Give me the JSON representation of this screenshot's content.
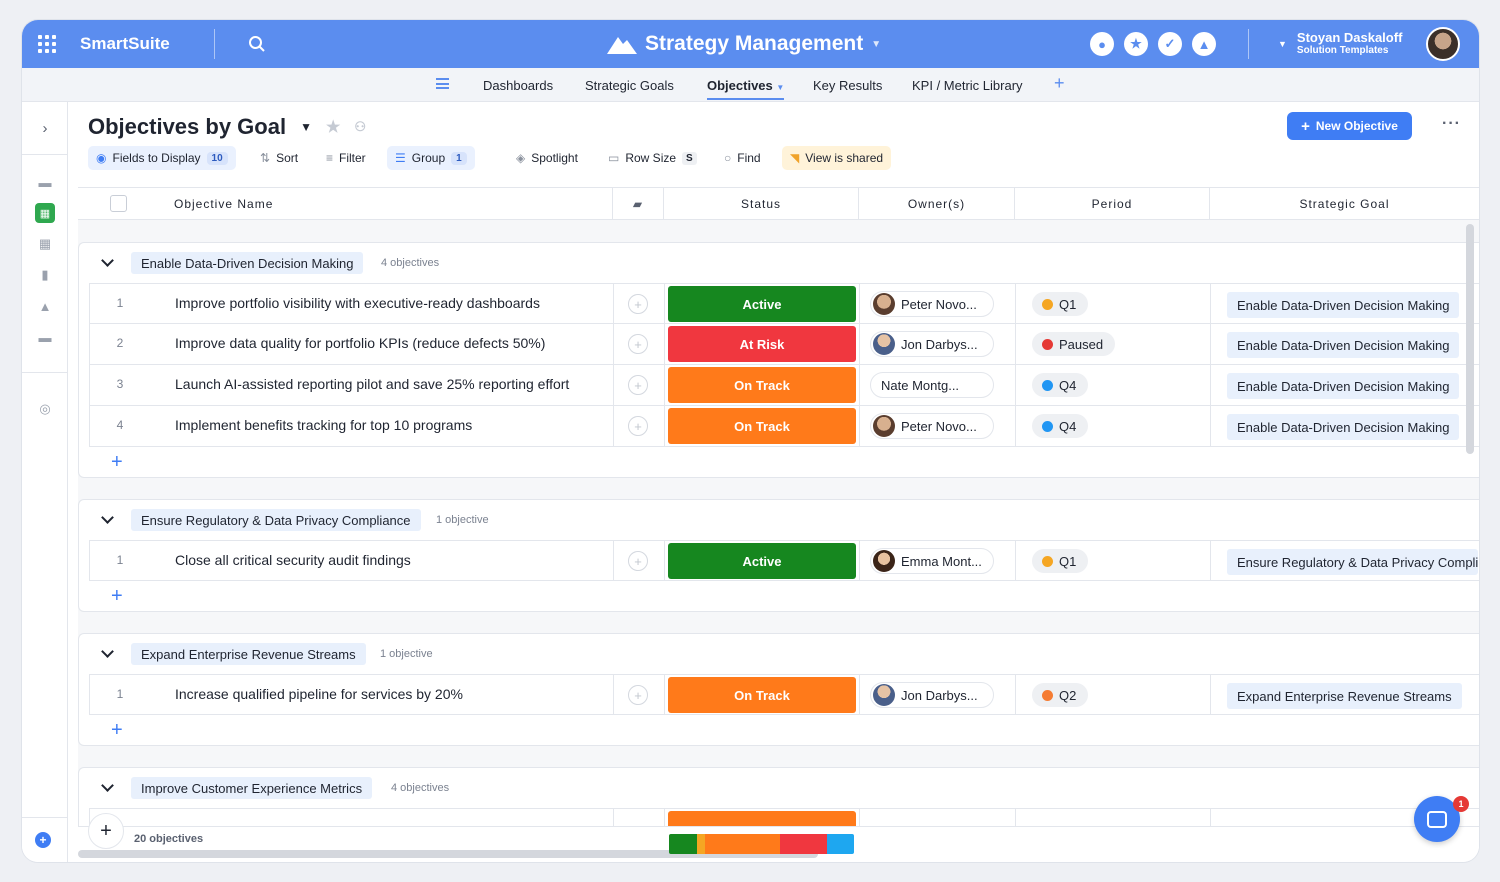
{
  "topbar": {
    "brand": "SmartSuite",
    "app_title": "Strategy Management",
    "user_name": "Stoyan Daskaloff",
    "user_role": "Solution Templates"
  },
  "nav_tabs": [
    "Dashboards",
    "Strategic Goals",
    "Objectives",
    "Key Results",
    "KPI / Metric Library"
  ],
  "view": {
    "title": "Objectives by Goal",
    "new_button": "New Objective"
  },
  "toolbar": {
    "fields_label": "Fields to Display",
    "fields_count": "10",
    "sort": "Sort",
    "filter": "Filter",
    "group": "Group",
    "group_count": "1",
    "spotlight": "Spotlight",
    "row_size": "Row Size",
    "row_size_value": "S",
    "find": "Find",
    "shared": "View is shared"
  },
  "columns": [
    "Objective Name",
    "Status",
    "Owner(s)",
    "Period",
    "Strategic Goal"
  ],
  "groups": [
    {
      "name": "Enable Data-Driven Decision Making",
      "count": "4 objectives",
      "rows": [
        {
          "idx": "1",
          "name": "Improve portfolio visibility with executive-ready dashboards",
          "status": "Active",
          "owner": "Peter Novo...",
          "period": "Q1",
          "goal": "Enable Data-Driven Decision Making"
        },
        {
          "idx": "2",
          "name": "Improve data quality for portfolio KPIs (reduce defects 50%)",
          "status": "At Risk",
          "owner": "Jon Darbys...",
          "period": "Paused",
          "goal": "Enable Data-Driven Decision Making"
        },
        {
          "idx": "3",
          "name": "Launch AI-assisted reporting pilot and save 25% reporting effort",
          "status": "On Track",
          "owner": "Nate Montg...",
          "period": "Q4",
          "goal": "Enable Data-Driven Decision Making"
        },
        {
          "idx": "4",
          "name": "Implement benefits tracking for top 10 programs",
          "status": "On Track",
          "owner": "Peter Novo...",
          "period": "Q4",
          "goal": "Enable Data-Driven Decision Making"
        }
      ]
    },
    {
      "name": "Ensure Regulatory & Data Privacy Compliance",
      "count": "1 objective",
      "rows": [
        {
          "idx": "1",
          "name": "Close all critical security audit findings",
          "status": "Active",
          "owner": "Emma Mont...",
          "period": "Q1",
          "goal": "Ensure Regulatory & Data Privacy Compli"
        }
      ]
    },
    {
      "name": "Expand Enterprise Revenue Streams",
      "count": "1 objective",
      "rows": [
        {
          "idx": "1",
          "name": "Increase qualified pipeline for services by 20%",
          "status": "On Track",
          "owner": "Jon Darbys...",
          "period": "Q2",
          "goal": "Expand Enterprise Revenue Streams"
        }
      ]
    },
    {
      "name": "Improve Customer Experience Metrics",
      "count": "4 objectives",
      "rows": []
    }
  ],
  "footer": {
    "record_count": "20 objectives"
  },
  "chat_badge": "1",
  "colors": {
    "active": "#16871f",
    "at_risk": "#f0373f",
    "on_track": "#ff7a1a",
    "q1": "#f5a623",
    "paused": "#e53935",
    "q4": "#2196f3",
    "q2": "#f57c33"
  }
}
